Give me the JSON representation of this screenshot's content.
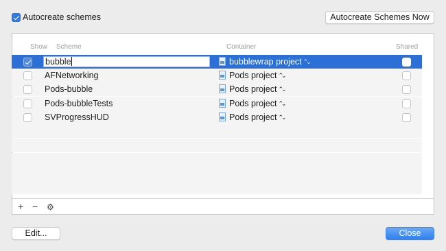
{
  "autocreate": {
    "label": "Autocreate schemes",
    "checked": true
  },
  "buttons": {
    "autocreate_now": "Autocreate Schemes Now",
    "edit": "Edit...",
    "close": "Close"
  },
  "table": {
    "headers": {
      "show": "Show",
      "scheme": "Scheme",
      "container": "Container",
      "shared": "Shared"
    },
    "rows": [
      {
        "show": true,
        "scheme": "bubble",
        "container": "bubblewrap project",
        "shared": false,
        "selected": true,
        "editing": true
      },
      {
        "show": false,
        "scheme": "AFNetworking",
        "container": "Pods project",
        "shared": false
      },
      {
        "show": false,
        "scheme": "Pods-bubble",
        "container": "Pods project",
        "shared": false
      },
      {
        "show": false,
        "scheme": "Pods-bubbleTests",
        "container": "Pods project",
        "shared": false
      },
      {
        "show": false,
        "scheme": "SVProgressHUD",
        "container": "Pods project",
        "shared": false
      }
    ]
  },
  "toolbar": {
    "add": "+",
    "remove": "−",
    "gear": "⚙"
  },
  "colors": {
    "selection": "#2c6fd6",
    "accent": "#2f80ee"
  },
  "icons": {
    "project": "project-file-icon",
    "popup": "up-down-chevron-icon",
    "gear": "gear-icon"
  }
}
